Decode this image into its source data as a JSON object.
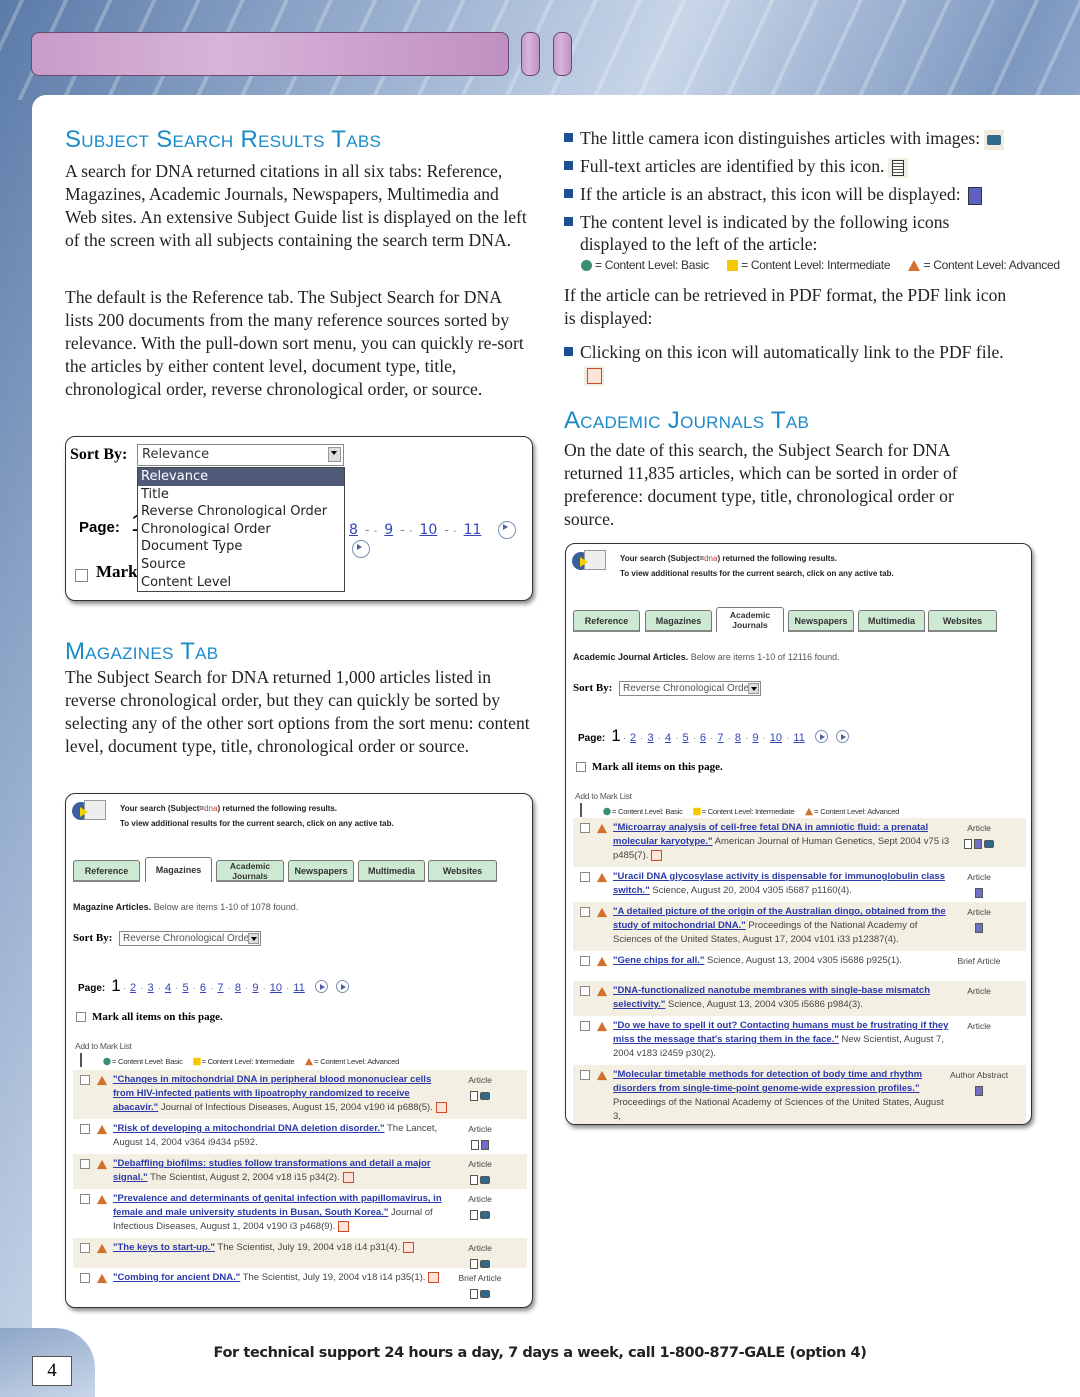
{
  "footer": {
    "support": "For technical support 24 hours a day, 7 days a week, call 1-800-877-GALE (option 4)",
    "page_number": "4"
  },
  "subject": {
    "heading": "Subject Search Results Tabs",
    "paras": [
      "A search for DNA returned citations in all six tabs: Reference, Magazines, Academic Journals, Newspapers, Multimedia and Web sites. An extensive Subject Guide list is displayed on the left of the screen with all subjects containing the search term DNA.",
      "The default is the Reference tab. The Subject Search for DNA lists 200 documents from the many reference sources sorted by relevance. With the pull-down sort menu, you can quickly re-sort the articles by either content level, document type, title, chronological order, reverse chronological order, or source."
    ]
  },
  "sort_demo": {
    "label": "Sort By:",
    "selected": "Relevance",
    "options": [
      "Relevance",
      "Title",
      "Reverse Chronological Order",
      "Chronological Order",
      "Document Type",
      "Source",
      "Content Level"
    ],
    "page_label": "Page:",
    "page_current": "1",
    "pages": [
      "8",
      "9",
      "10",
      "11"
    ],
    "mark": "Mark"
  },
  "magazines": {
    "heading": "Magazines Tab",
    "para": "The Subject Search for DNA returned 1,000 articles listed in reverse chronological order, but they can quickly be sorted by selecting any of the other sort options from the sort menu: content level, document type, title, chronological order or source."
  },
  "academic": {
    "heading": "Academic Journals Tab",
    "para": "On the date of this search, the Subject Search for DNA returned 11,835 articles, which can be sorted in order of preference: document type, title, chronological order or source."
  },
  "bullets": [
    "The little camera icon distinguishes articles with images:",
    "Full-text articles are identified by this icon.",
    "If the article is an abstract, this icon will be displayed:",
    "The content level is indicated by the following icons displayed to the left of the article:"
  ],
  "pdf_text": "If the article can be retrieved in PDF format, the PDF link icon is displayed:",
  "pdf_bullet": "Clicking on this icon will automatically link to the PDF file.",
  "legend": {
    "basic": "= Content Level: Basic",
    "intermediate": "= Content Level: Intermediate",
    "advanced": "= Content Level: Advanced"
  },
  "colors": {
    "heading": "#1b8ac8",
    "basic": "#3a8c74",
    "intermediate": "#f5c800",
    "advanced": "#d2702e",
    "link": "#2b3aa8",
    "tab": "#cde9d4"
  },
  "common": {
    "search_pre": "Your search (Subject=",
    "search_term": "dna",
    "search_post": ") returned the following results.",
    "search_line2": "To view additional results for the current search, click on any active tab.",
    "tabs": [
      "Reference",
      "Magazines",
      "Academic Journals",
      "Newspapers",
      "Multimedia",
      "Websites"
    ],
    "sort_label": "Sort By:",
    "sort_value": "Reverse Chronological Order",
    "page_label": "Page:",
    "page_current": "1",
    "pages": [
      "2",
      "3",
      "4",
      "5",
      "6",
      "7",
      "8",
      "9",
      "10",
      "11"
    ],
    "mark_all": "Mark all items on this page.",
    "add_to_mark": "Add to Mark List"
  },
  "mag_panel": {
    "active_tab": 1,
    "section_bold": "Magazine Articles.",
    "section_rest": "Below are items 1-10 of 1078 found.",
    "results": [
      {
        "title": "\"Changes in mitochondrial DNA in peripheral blood mononuclear cells from HIV-infected patients with lipoatrophy randomized to receive abacavir.\"",
        "source": "Journal of Infectious Diseases, August 15, 2004 v190 i4 p688(5).",
        "type": "Article",
        "icons": [
          "full",
          "camera"
        ],
        "pdf": true
      },
      {
        "title": "\"Risk of developing a mitochondrial DNA deletion disorder.\"",
        "source": "The Lancet, August 14, 2004 v364 i9434 p592.",
        "type": "Article",
        "icons": [
          "full",
          "abstract"
        ],
        "pdf": false
      },
      {
        "title": "\"Debaffling biofilms: studies follow transformations and detail a major signal.\"",
        "source": "The Scientist, August 2, 2004 v18 i15 p34(2).",
        "type": "Article",
        "icons": [
          "full",
          "camera"
        ],
        "pdf": true
      },
      {
        "title": "\"Prevalence and determinants of genital infection with papillomavirus, in female and male university students in Busan, South Korea.\"",
        "source": "Journal of Infectious Diseases, August 1, 2004 v190 i3 p468(9).",
        "type": "Article",
        "icons": [
          "full",
          "camera"
        ],
        "pdf": true
      },
      {
        "title": "\"The keys to start-up.\"",
        "source": "The Scientist, July 19, 2004 v18 i14 p31(4).",
        "type": "Article",
        "icons": [
          "full",
          "camera"
        ],
        "pdf": true
      },
      {
        "title": "\"Combing for ancient DNA.\"",
        "source": "The Scientist, July 19, 2004 v18 i14 p35(1).",
        "type": "Brief Article",
        "icons": [
          "full",
          "camera"
        ],
        "pdf": true
      }
    ]
  },
  "acad_panel": {
    "active_tab": 2,
    "section_bold": "Academic Journal Articles.",
    "section_rest": "Below are items 1-10 of 12116 found.",
    "results": [
      {
        "title": "\"Microarray analysis of cell-free fetal DNA in amniotic fluid: a prenatal molecular karyotype.\"",
        "source": "American Journal of Human Genetics, Sept 2004 v75 i3 p485(7).",
        "type": "Article",
        "icons": [
          "full",
          "abstract",
          "camera"
        ],
        "pdf": true
      },
      {
        "title": "\"Uracil DNA glycosylase activity is dispensable for immunoglobulin class switch.\"",
        "source": "Science, August 20, 2004 v305 i5687 p1160(4).",
        "type": "Article",
        "icons": [
          "abstract"
        ],
        "pdf": false
      },
      {
        "title": "\"A detailed picture of the origin of the Australian dingo, obtained from the study of mitochondrial DNA.\"",
        "source": "Proceedings of the National Academy of Sciences of the United States, August 17, 2004 v101 i33 p12387(4).",
        "type": "Article",
        "icons": [
          "abstract"
        ],
        "pdf": false
      },
      {
        "title": "\"Gene chips for all.\"",
        "source": "Science, August 13, 2004 v305 i5686 p925(1).",
        "type": "Brief Article",
        "icons": [],
        "pdf": false
      },
      {
        "title": "\"DNA-functionalized nanotube membranes with single-base mismatch selectivity.\"",
        "source": "Science, August 13, 2004 v305 i5686 p984(3).",
        "type": "Article",
        "icons": [],
        "pdf": false
      },
      {
        "title": "\"Do we have to spell it out? Contacting humans must be frustrating if they miss the message that's staring them in the face.\"",
        "source": "New Scientist, August 7, 2004 v183 i2459 p30(2).",
        "type": "Article",
        "icons": [],
        "pdf": false
      },
      {
        "title": "\"Molecular timetable methods for detection of body time and rhythm disorders from single-time-point genome-wide expression profiles.\"",
        "source": "Proceedings of the National Academy of Sciences of the United States, August 3,",
        "type": "Author Abstract",
        "icons": [
          "abstract"
        ],
        "pdf": false
      }
    ]
  }
}
